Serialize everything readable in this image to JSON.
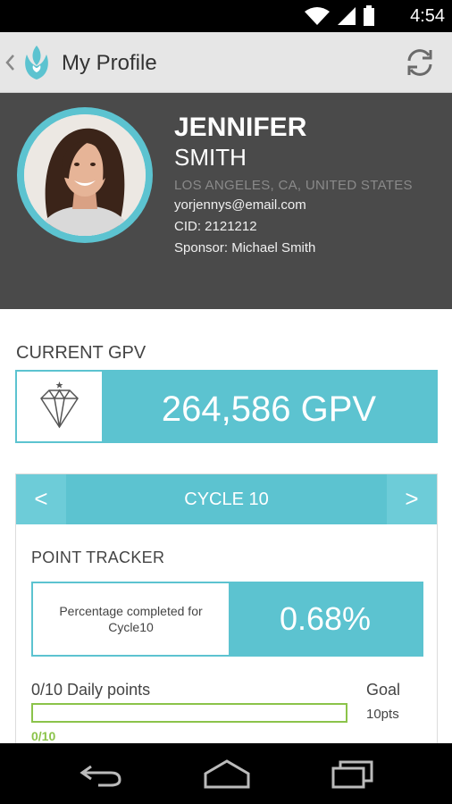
{
  "status_bar": {
    "time": "4:54",
    "icons": [
      "wifi-icon",
      "signal-icon",
      "battery-icon"
    ]
  },
  "app_bar": {
    "title": "My Profile",
    "icons": [
      "back-chevron-icon",
      "app-logo",
      "refresh-icon"
    ]
  },
  "profile": {
    "first_name": "JENNIFER",
    "last_name": "SMITH",
    "location": "LOS ANGELES, CA, UNITED STATES",
    "email": "yorjennys@email.com",
    "cid": "CID: 2121212",
    "sponsor": "Sponsor: Michael Smith"
  },
  "gpv": {
    "label": "CURRENT GPV",
    "value": "264,586 GPV",
    "icon": "diamond-icon"
  },
  "cycle": {
    "prev_label": "<",
    "title": "CYCLE 10",
    "next_label": ">"
  },
  "point_tracker": {
    "title": "POINT TRACKER",
    "caption": "Percentage completed for Cycle10",
    "percentage": "0.68%",
    "daily_label": "0/10 Daily points",
    "daily_progress_text": "0/10",
    "daily_progress_fraction": 0,
    "goal_label": "Goal",
    "goal_value": "10pts"
  },
  "nav_bar": {
    "buttons": [
      "back-icon",
      "home-icon",
      "recents-icon"
    ]
  },
  "colors": {
    "accent": "#5cc3d0",
    "header_bg": "#4a4a4a",
    "progress_green": "#8bc34a"
  }
}
